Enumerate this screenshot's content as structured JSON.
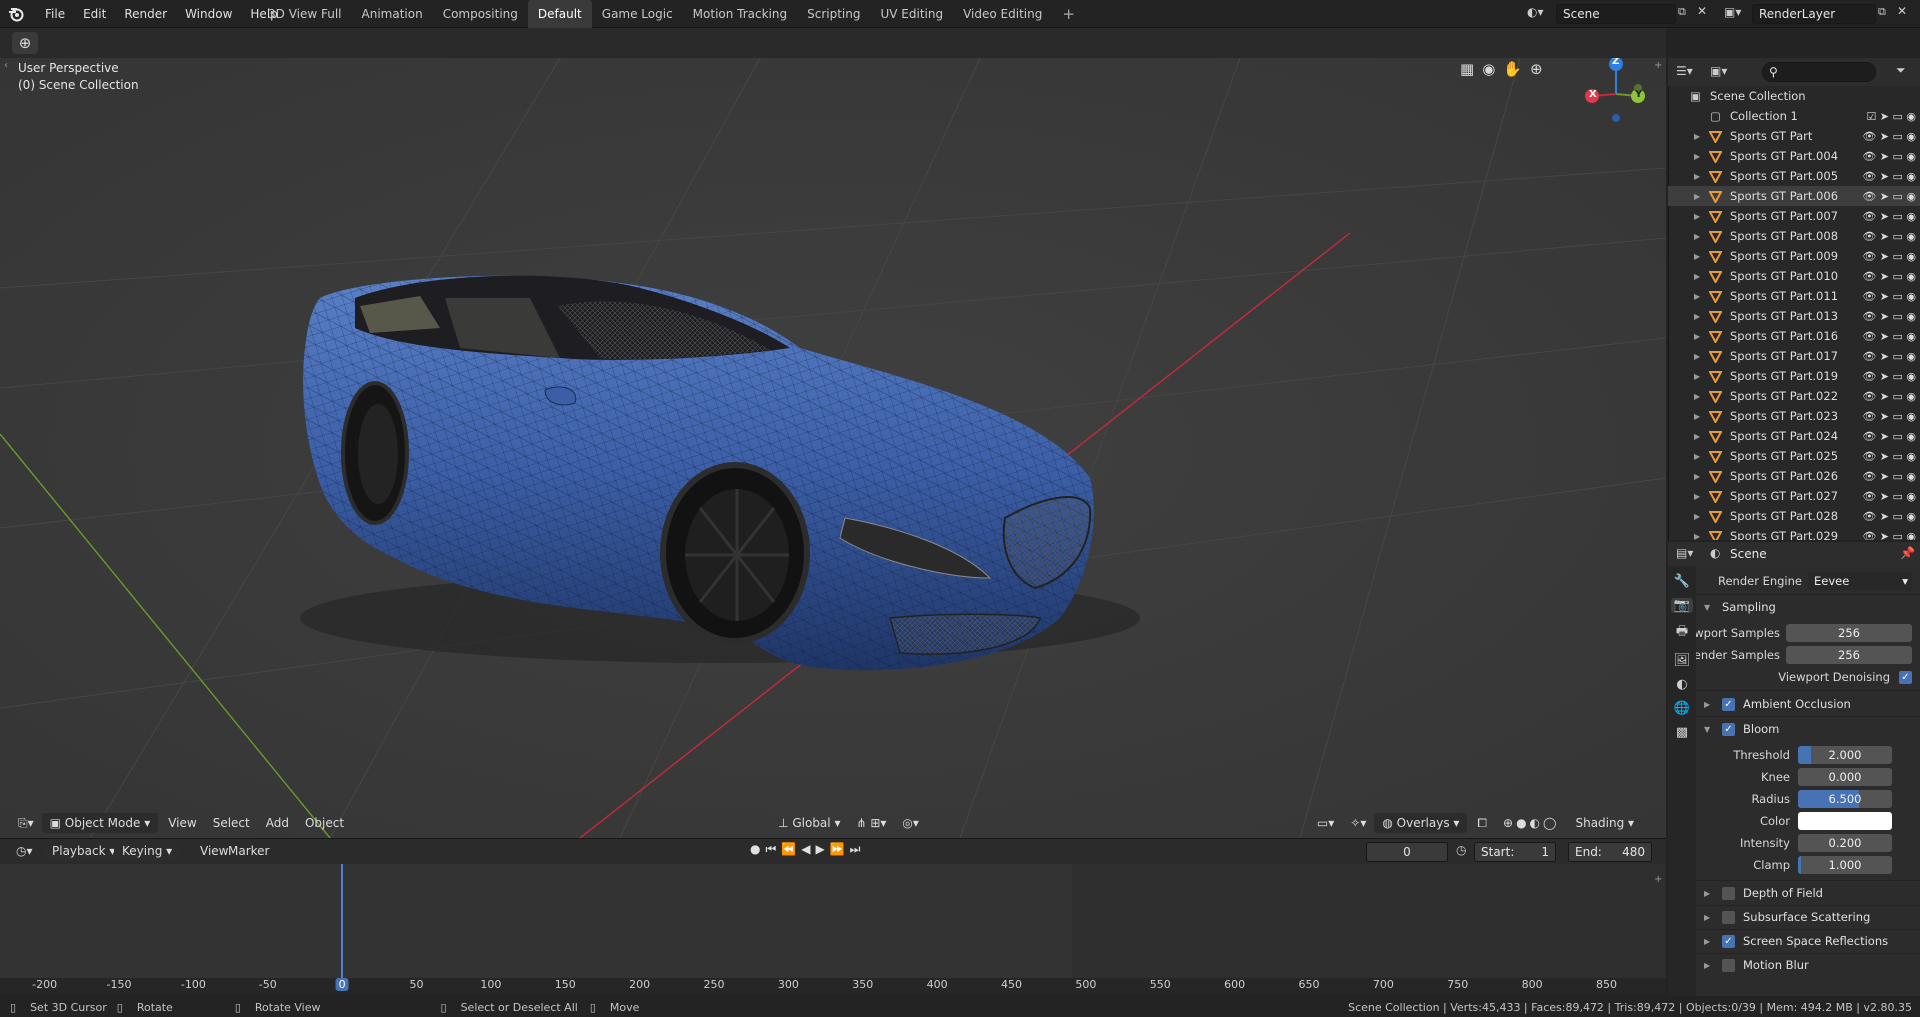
{
  "topbar": {
    "menus": [
      "File",
      "Edit",
      "Render",
      "Window",
      "Help"
    ],
    "workspaces": [
      "3D View Full",
      "Animation",
      "Compositing",
      "Default",
      "Game Logic",
      "Motion Tracking",
      "Scripting",
      "UV Editing",
      "Video Editing"
    ],
    "active_workspace": "Default",
    "add_workspace": "+",
    "scene_name": "Scene",
    "view_layer": "RenderLayer"
  },
  "viewport": {
    "perspective_label": "User Perspective",
    "collection_label": "(0) Scene Collection",
    "gizmo": {
      "z": "Z",
      "x": "X",
      "y": "Y"
    },
    "header": {
      "mode": "Object Mode",
      "menus": [
        "View",
        "Select",
        "Add",
        "Object"
      ],
      "orientation": "Global",
      "overlays": "Overlays",
      "shading": "Shading"
    }
  },
  "timeline": {
    "playback": "Playback",
    "keying": "Keying",
    "menus": [
      "View",
      "Marker"
    ],
    "current_frame": "0",
    "start_label": "Start:",
    "start": "1",
    "end_label": "End:",
    "end": "480",
    "ruler": [
      "-200",
      "-150",
      "-100",
      "-50",
      "0",
      "50",
      "100",
      "150",
      "200",
      "250",
      "300",
      "350",
      "400",
      "450",
      "500",
      "550",
      "600",
      "650",
      "700",
      "750",
      "800",
      "850"
    ],
    "playhead_frame": "0"
  },
  "outliner": {
    "root": "Scene Collection",
    "collection": "Collection 1",
    "items": [
      "Sports GT Part",
      "Sports GT Part.004",
      "Sports GT Part.005",
      "Sports GT Part.006",
      "Sports GT Part.007",
      "Sports GT Part.008",
      "Sports GT Part.009",
      "Sports GT Part.010",
      "Sports GT Part.011",
      "Sports GT Part.013",
      "Sports GT Part.016",
      "Sports GT Part.017",
      "Sports GT Part.019",
      "Sports GT Part.022",
      "Sports GT Part.023",
      "Sports GT Part.024",
      "Sports GT Part.025",
      "Sports GT Part.026",
      "Sports GT Part.027",
      "Sports GT Part.028",
      "Sports GT Part.029"
    ],
    "selected_index": 3
  },
  "properties": {
    "context": "Scene",
    "render_engine_label": "Render Engine",
    "render_engine": "Eevee",
    "sampling": "Sampling",
    "viewport_samples_label": "Viewport Samples",
    "viewport_samples": "256",
    "render_samples_label": "Render Samples",
    "render_samples": "256",
    "viewport_denoising": "Viewport Denoising",
    "ambient_occlusion": "Ambient Occlusion",
    "bloom": "Bloom",
    "threshold_label": "Threshold",
    "threshold": "2.000",
    "knee_label": "Knee",
    "knee": "0.000",
    "radius_label": "Radius",
    "radius": "6.500",
    "color_label": "Color",
    "intensity_label": "Intensity",
    "intensity": "0.200",
    "clamp_label": "Clamp",
    "clamp": "1.000",
    "depth_of_field": "Depth of Field",
    "subsurface_scattering": "Subsurface Scattering",
    "screen_space_reflections": "Screen Space Reflections",
    "motion_blur": "Motion Blur"
  },
  "statusbar": {
    "hints": [
      "Set 3D Cursor",
      "Rotate",
      "Rotate View",
      "Select or Deselect All",
      "Move"
    ],
    "stats": "Scene Collection | Verts:45,433 | Faces:89,472 | Tris:89,472 | Objects:0/39 | Mem: 494.2 MB | v2.80.35"
  },
  "colors": {
    "accent": "#4772b3",
    "object_icon": "#e89a3c",
    "car_body": "#3b5ea6",
    "x_axis": "#c8283c",
    "y_axis": "#6a9a2a",
    "z_axis": "#2f7fe0"
  }
}
